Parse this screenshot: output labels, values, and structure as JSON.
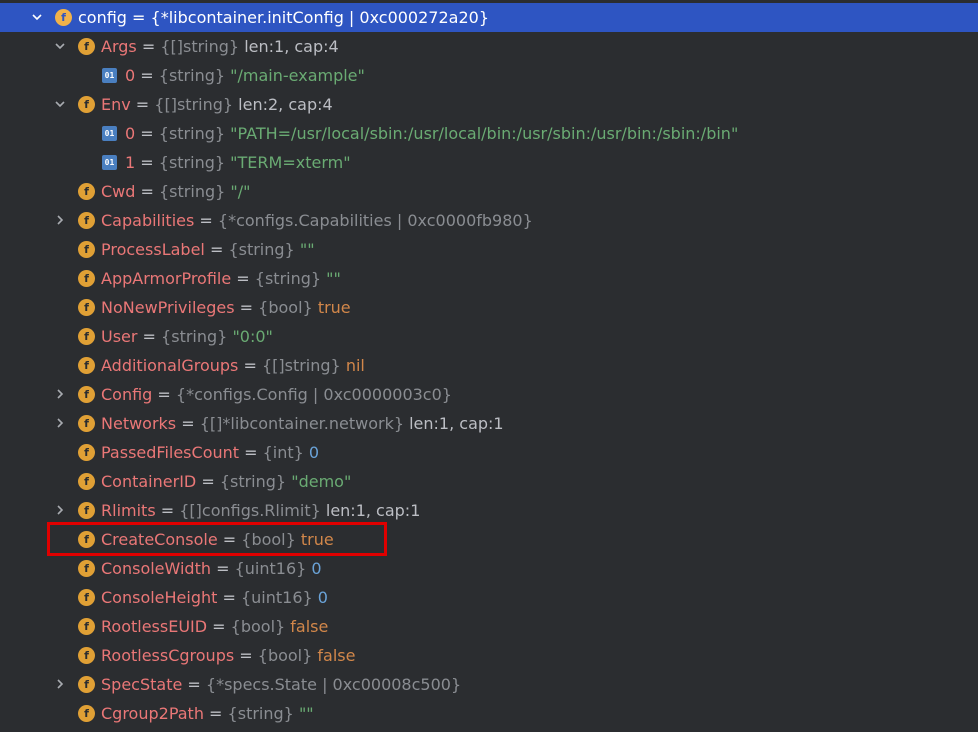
{
  "rows": [
    {
      "depth": 0,
      "arrow": "down",
      "icon": "f",
      "name": "config",
      "type": "{*libcontainer.initConfig | 0xc000272a20}",
      "value": "",
      "vclass": "",
      "selected": true
    },
    {
      "depth": 1,
      "arrow": "down",
      "icon": "f",
      "name": "Args",
      "type": "{[]string}",
      "value": "len:1, cap:4",
      "vclass": "len"
    },
    {
      "depth": 2,
      "arrow": "",
      "icon": "01",
      "name": "0",
      "type": "{string}",
      "value": "\"/main-example\"",
      "vclass": "str"
    },
    {
      "depth": 1,
      "arrow": "down",
      "icon": "f",
      "name": "Env",
      "type": "{[]string}",
      "value": "len:2, cap:4",
      "vclass": "len"
    },
    {
      "depth": 2,
      "arrow": "",
      "icon": "01",
      "name": "0",
      "type": "{string}",
      "value": "\"PATH=/usr/local/sbin:/usr/local/bin:/usr/sbin:/usr/bin:/sbin:/bin\"",
      "vclass": "str"
    },
    {
      "depth": 2,
      "arrow": "",
      "icon": "01",
      "name": "1",
      "type": "{string}",
      "value": "\"TERM=xterm\"",
      "vclass": "str"
    },
    {
      "depth": 1,
      "arrow": "",
      "icon": "f",
      "name": "Cwd",
      "type": "{string}",
      "value": "\"/\"",
      "vclass": "str"
    },
    {
      "depth": 1,
      "arrow": "right",
      "icon": "f",
      "name": "Capabilities",
      "type": "{*configs.Capabilities | 0xc0000fb980}",
      "value": "",
      "vclass": ""
    },
    {
      "depth": 1,
      "arrow": "",
      "icon": "f",
      "name": "ProcessLabel",
      "type": "{string}",
      "value": "\"\"",
      "vclass": "str"
    },
    {
      "depth": 1,
      "arrow": "",
      "icon": "f",
      "name": "AppArmorProfile",
      "type": "{string}",
      "value": "\"\"",
      "vclass": "str"
    },
    {
      "depth": 1,
      "arrow": "",
      "icon": "f",
      "name": "NoNewPrivileges",
      "type": "{bool}",
      "value": "true",
      "vclass": "kw"
    },
    {
      "depth": 1,
      "arrow": "",
      "icon": "f",
      "name": "User",
      "type": "{string}",
      "value": "\"0:0\"",
      "vclass": "str"
    },
    {
      "depth": 1,
      "arrow": "",
      "icon": "f",
      "name": "AdditionalGroups",
      "type": "{[]string}",
      "value": "nil",
      "vclass": "kw"
    },
    {
      "depth": 1,
      "arrow": "right",
      "icon": "f",
      "name": "Config",
      "type": "{*configs.Config | 0xc0000003c0}",
      "value": "",
      "vclass": ""
    },
    {
      "depth": 1,
      "arrow": "right",
      "icon": "f",
      "name": "Networks",
      "type": "{[]*libcontainer.network}",
      "value": "len:1, cap:1",
      "vclass": "len"
    },
    {
      "depth": 1,
      "arrow": "",
      "icon": "f",
      "name": "PassedFilesCount",
      "type": "{int}",
      "value": "0",
      "vclass": "num"
    },
    {
      "depth": 1,
      "arrow": "",
      "icon": "f",
      "name": "ContainerID",
      "type": "{string}",
      "value": "\"demo\"",
      "vclass": "str"
    },
    {
      "depth": 1,
      "arrow": "right",
      "icon": "f",
      "name": "Rlimits",
      "type": "{[]configs.Rlimit}",
      "value": "len:1, cap:1",
      "vclass": "len"
    },
    {
      "depth": 1,
      "arrow": "",
      "icon": "f",
      "name": "CreateConsole",
      "type": "{bool}",
      "value": "true",
      "vclass": "kw",
      "highlighted": true
    },
    {
      "depth": 1,
      "arrow": "",
      "icon": "f",
      "name": "ConsoleWidth",
      "type": "{uint16}",
      "value": "0",
      "vclass": "num"
    },
    {
      "depth": 1,
      "arrow": "",
      "icon": "f",
      "name": "ConsoleHeight",
      "type": "{uint16}",
      "value": "0",
      "vclass": "num"
    },
    {
      "depth": 1,
      "arrow": "",
      "icon": "f",
      "name": "RootlessEUID",
      "type": "{bool}",
      "value": "false",
      "vclass": "kw"
    },
    {
      "depth": 1,
      "arrow": "",
      "icon": "f",
      "name": "RootlessCgroups",
      "type": "{bool}",
      "value": "false",
      "vclass": "kw"
    },
    {
      "depth": 1,
      "arrow": "right",
      "icon": "f",
      "name": "SpecState",
      "type": "{*specs.State | 0xc00008c500}",
      "value": "",
      "vclass": ""
    },
    {
      "depth": 1,
      "arrow": "",
      "icon": "f",
      "name": "Cgroup2Path",
      "type": "{string}",
      "value": "\"\"",
      "vclass": "str"
    }
  ],
  "icons": {
    "field": "f",
    "element": "01"
  }
}
